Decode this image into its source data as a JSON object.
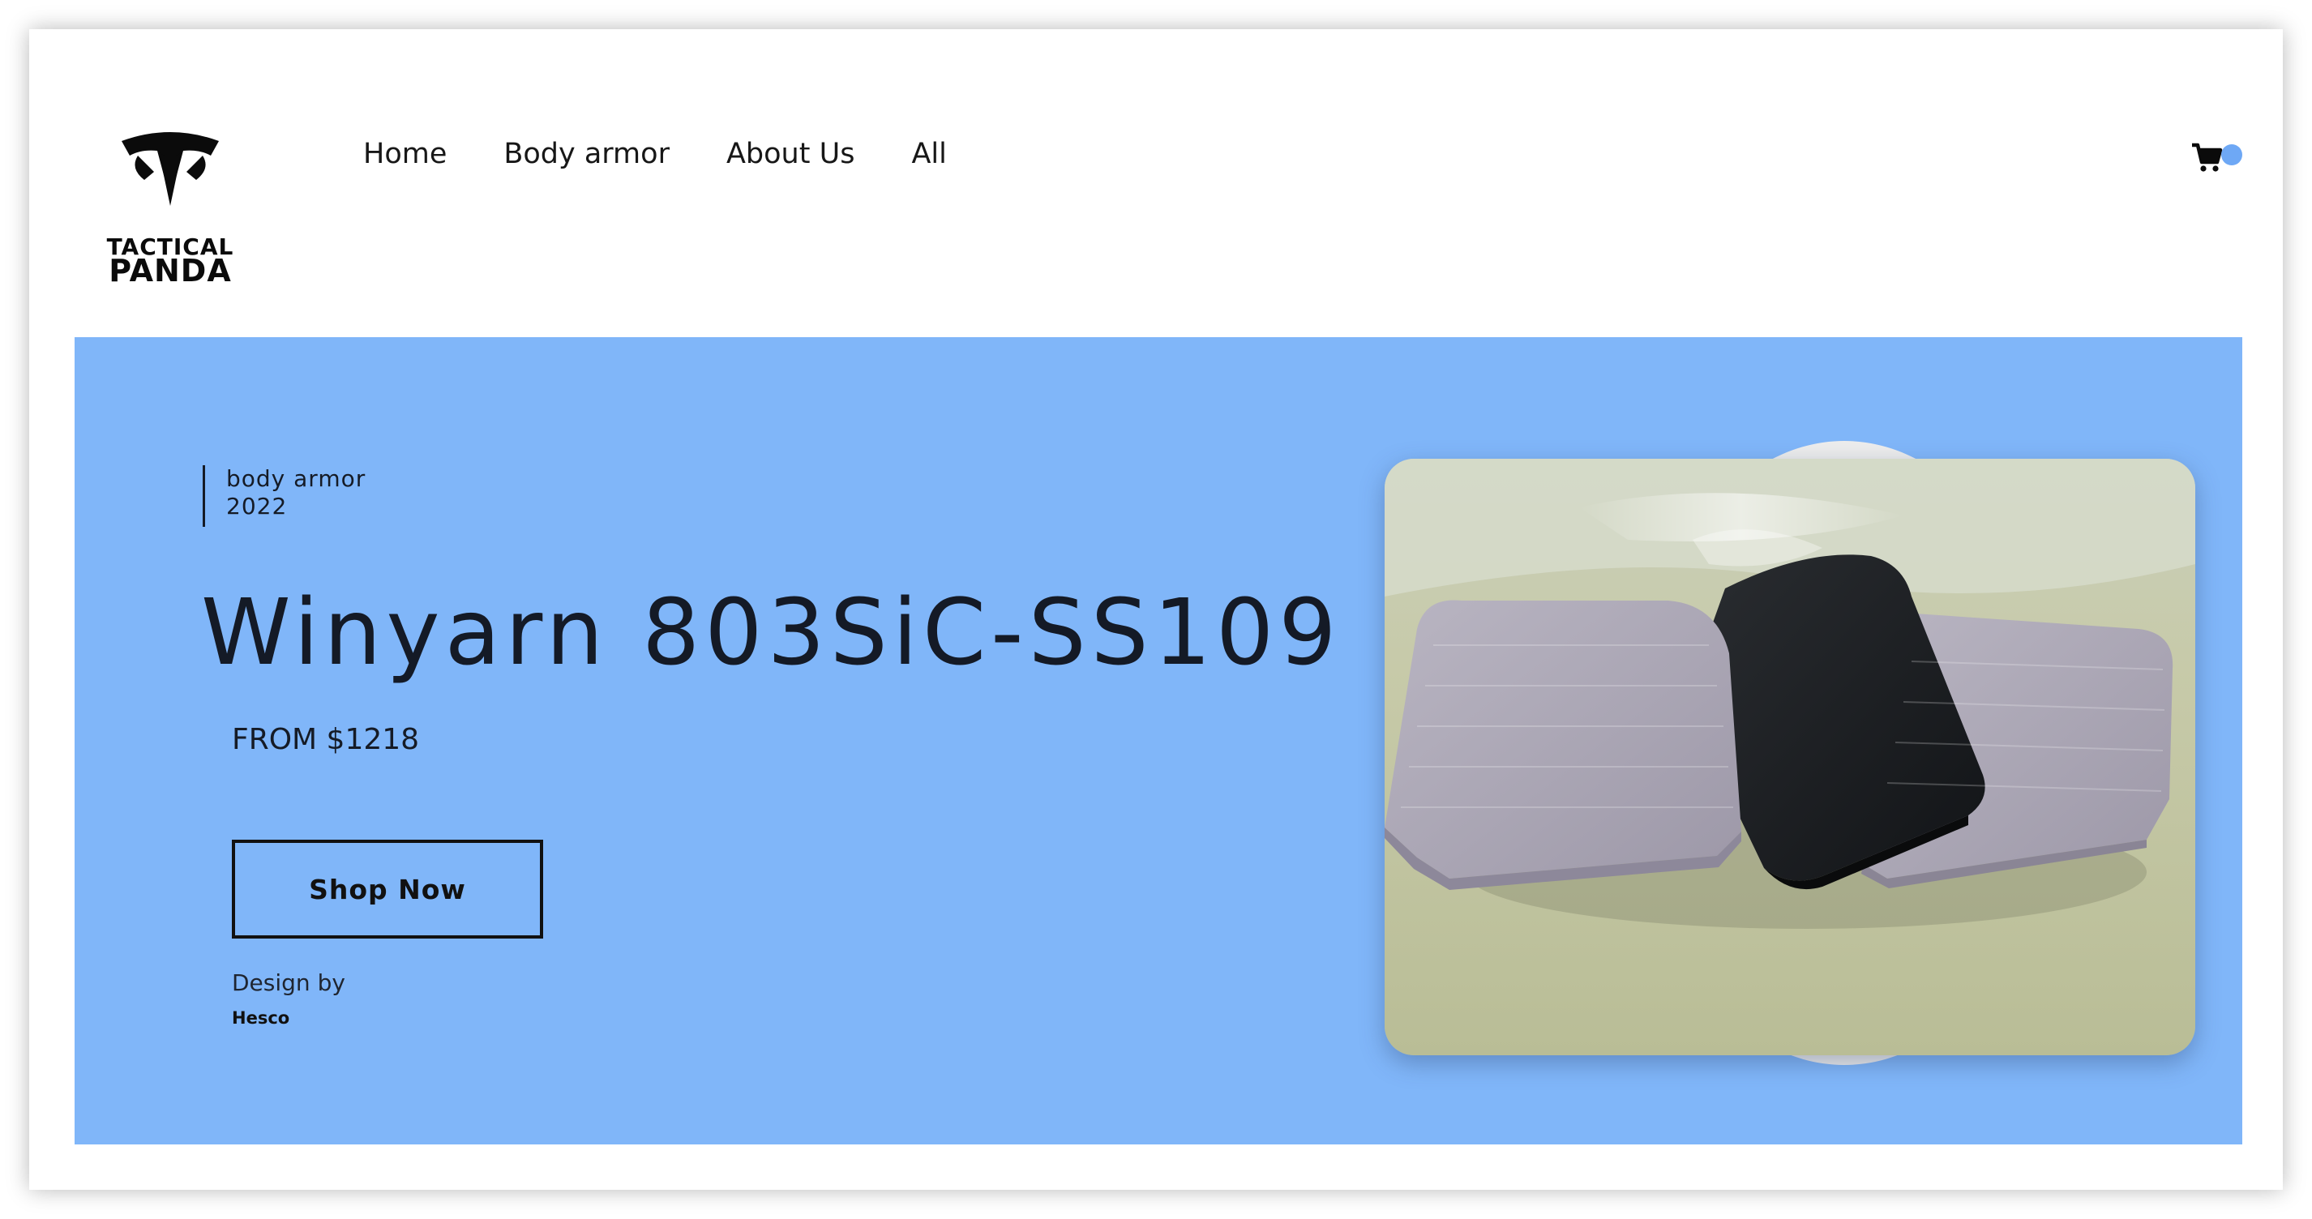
{
  "brand": {
    "line1": "TACTICAL",
    "line2": "PANDA",
    "icon": "panda-helmet-logo"
  },
  "nav": {
    "items": [
      {
        "label": "Home"
      },
      {
        "label": "Body armor"
      },
      {
        "label": "About Us"
      },
      {
        "label": "All"
      }
    ]
  },
  "cart": {
    "icon": "shopping-cart-icon",
    "badge_color": "#6ea8f5"
  },
  "hero": {
    "category": "body armor",
    "year": "2022",
    "title": "Winyarn 803SiC-SS109",
    "price": "FROM $1218",
    "cta_label": "Shop Now",
    "design_by_label": "Design by",
    "designer": "Hesco",
    "background_color": "#80b6f9",
    "image": "three-ceramic-armor-plates-photo"
  }
}
